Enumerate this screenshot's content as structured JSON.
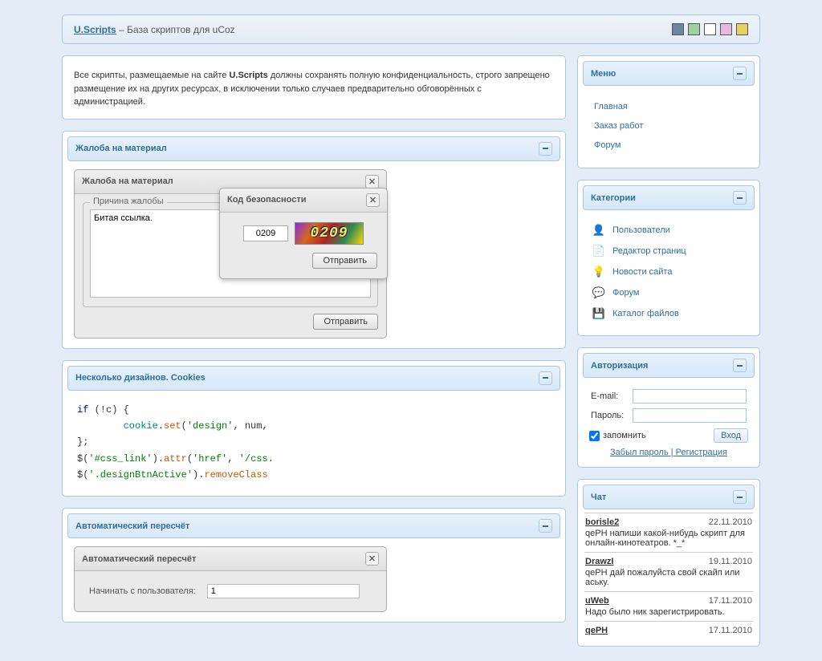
{
  "header": {
    "brand": "U.Scripts",
    "sep": " – ",
    "tagline": "База скриптов для uCoz"
  },
  "theme_colors": [
    "#6F84A3",
    "#9ED39E",
    "#FFFFFF",
    "#E7B8E0",
    "#E7CF62"
  ],
  "notice": {
    "pre": "Все скрипты, размещаемые на сайте ",
    "bold": "U.Scripts",
    "post": " должны сохранять полную конфиденциальность, строго запрещено размещение их на других ресурсах, в исключении только случаев предварительно обговорённых с администрацией."
  },
  "complaint": {
    "panel_title": "Жалоба на материал",
    "dialog_title": "Жалоба на материал",
    "fieldset_legend": "Причина жалобы",
    "textarea_value": "Битая ссылка.",
    "submit_label": "Отправить"
  },
  "security": {
    "title": "Код безопасности",
    "input_value": "0209",
    "captcha_text": "0209",
    "submit_label": "Отправить"
  },
  "designs": {
    "panel_title": "Несколько дизайнов. Cookies",
    "code": {
      "l1_if": "if",
      "l1_rest": " (!c) {",
      "l2_ind": "        ",
      "l2_obj": "cookie",
      "l2_dot": ".",
      "l2_fn": "set",
      "l2_p1": "(",
      "l2_s1": "'design'",
      "l2_c1": ", num,",
      "l3": "};",
      "l4_a": "$(",
      "l4_s1": "'#css_link'",
      "l4_b": ").",
      "l4_fn1": "attr",
      "l4_c": "(",
      "l4_s2": "'href'",
      "l4_d": ", ",
      "l4_s3": "'/css.",
      "l5_a": "$(",
      "l5_s1": "'.designBtnActive'",
      "l5_b": ").",
      "l5_fn1": "removeClass"
    }
  },
  "recalc": {
    "panel_title": "Автоматический пересчёт",
    "dialog_title": "Автоматический пересчёт",
    "row1_label": "Начинать с пользователя:",
    "row1_value": "1"
  },
  "sidebar": {
    "menu_title": "Меню",
    "menu_items": [
      "Главная",
      "Заказ работ",
      "Форум"
    ],
    "cat_title": "Категории",
    "cat_items": [
      {
        "icon": "users-icon",
        "glyph": "👤",
        "label": "Пользователи"
      },
      {
        "icon": "page-icon",
        "glyph": "📄",
        "label": "Редактор страниц"
      },
      {
        "icon": "bulb-icon",
        "glyph": "💡",
        "label": "Новости сайта"
      },
      {
        "icon": "bubble-icon",
        "glyph": "💬",
        "label": "Форум"
      },
      {
        "icon": "disk-icon",
        "glyph": "💾",
        "label": "Каталог файлов"
      }
    ],
    "auth_title": "Авторизация",
    "auth_email_label": "E-mail:",
    "auth_pass_label": "Пароль:",
    "auth_remember": "запомнить",
    "auth_submit": "Вход",
    "auth_forgot": "Забыл пароль",
    "auth_sep": " | ",
    "auth_register": "Регистрация",
    "chat_title": "Чат",
    "chat": [
      {
        "user": "borisle2",
        "date": "22.11.2010",
        "text": "qePH напиши какой-нибудь скрипт для онлайн-кинотеатров. *_*"
      },
      {
        "user": "DrawzI",
        "date": "19.11.2010",
        "text": "qePH дай пожалуйста свой скайп или аську."
      },
      {
        "user": "uWeb",
        "date": "17.11.2010",
        "text": "Надо было ник зарегистрировать."
      },
      {
        "user": "qePH",
        "date": "17.11.2010",
        "text": ""
      }
    ]
  }
}
